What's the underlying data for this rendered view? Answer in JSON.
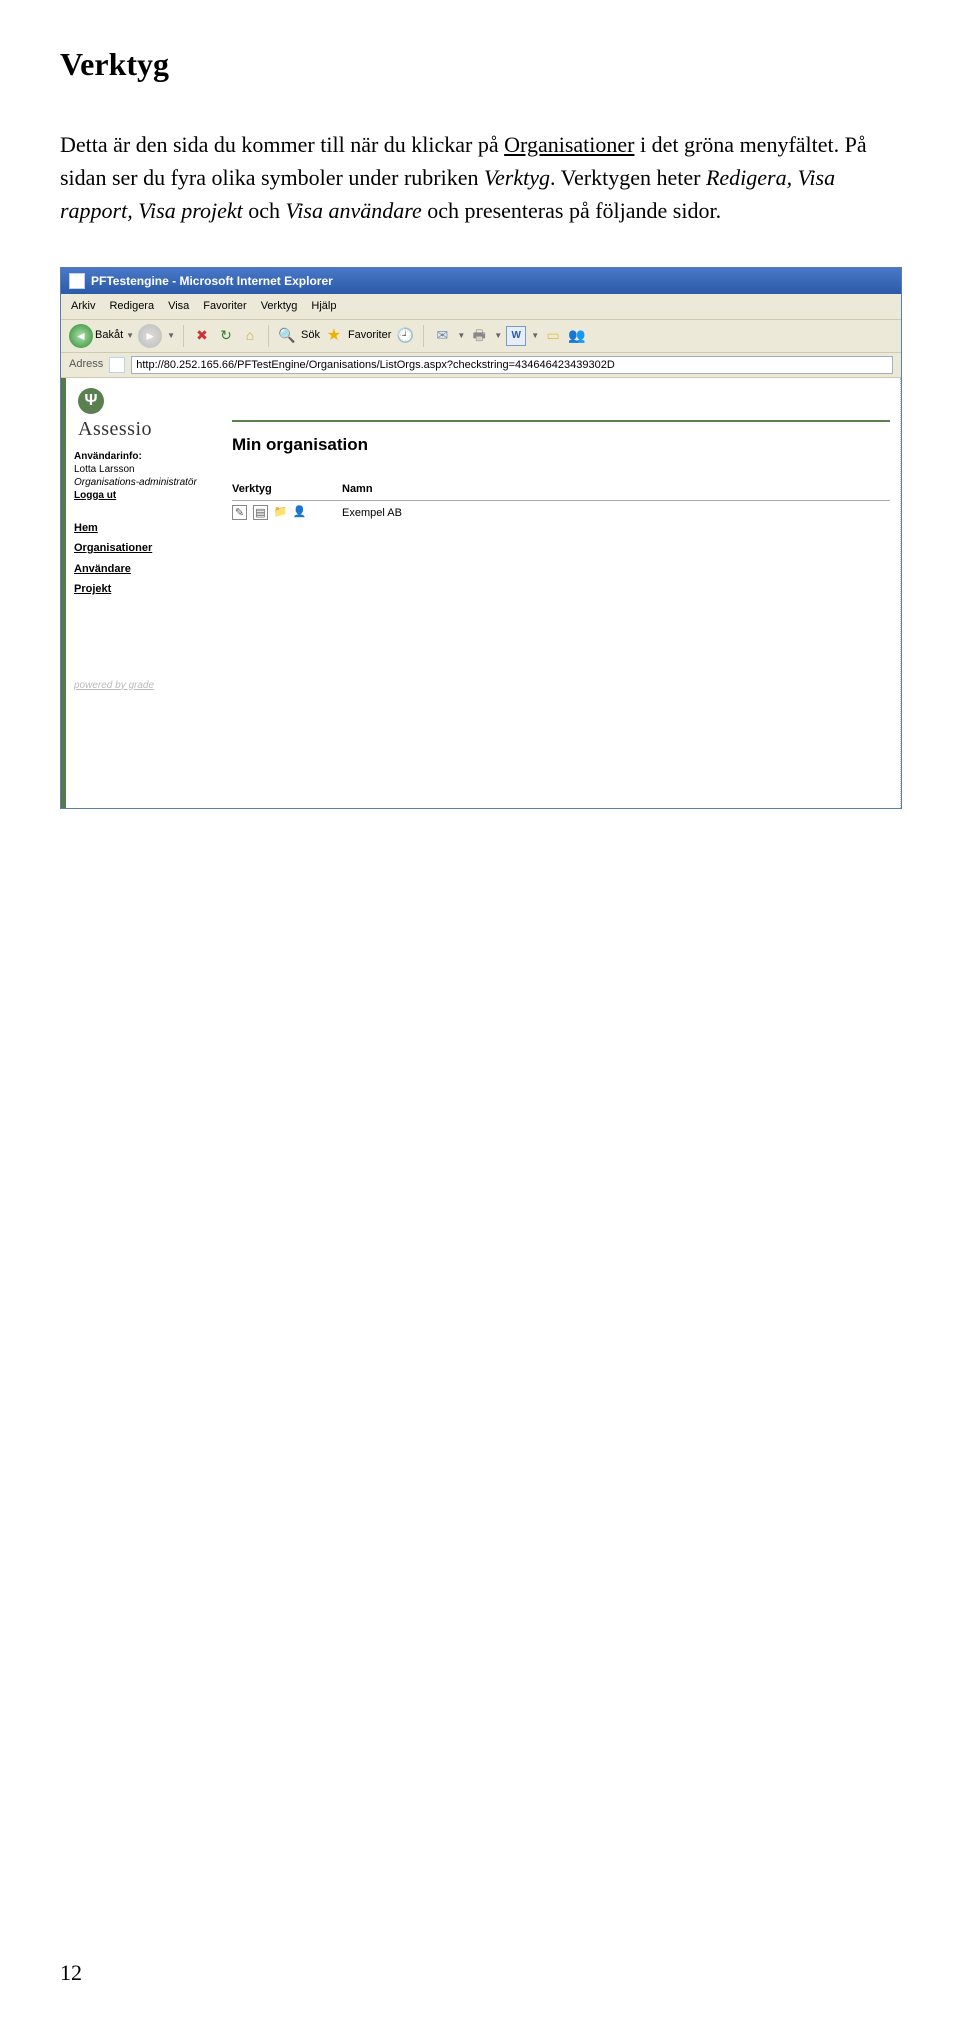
{
  "doc": {
    "heading": "Verktyg",
    "para1a": "Detta är den sida du kommer till när du klickar på ",
    "para1link": "Organisationer",
    "para1b": " i det gröna menyfältet. På sidan ser du fyra olika symboler under rubriken ",
    "para1italic1": "Verktyg",
    "para1c": ". Verktygen heter ",
    "para1italic2": "Redigera, Visa rapport, Visa projekt",
    "para1d": " och ",
    "para1italic3": "Visa användare",
    "para1e": " och presenteras på följande sidor.",
    "pagenum": "12"
  },
  "ie": {
    "title": "PFTestengine - Microsoft Internet Explorer",
    "menu": {
      "arkiv": "Arkiv",
      "redigera": "Redigera",
      "visa": "Visa",
      "favoriter": "Favoriter",
      "verktyg": "Verktyg",
      "hjalp": "Hjälp"
    },
    "toolbar": {
      "back": "Bakåt",
      "search": "Sök",
      "favorites": "Favoriter"
    },
    "address_label": "Adress",
    "address_url": "http://80.252.165.66/PFTestEngine/Organisations/ListOrgs.aspx?checkstring=434646423439302D"
  },
  "app": {
    "logo_text": "Assessio",
    "userinfo_label": "Användarinfo:",
    "user_name": "Lotta Larsson",
    "user_role": "Organisations-administratör",
    "logout": "Logga ut",
    "nav": {
      "hem": "Hem",
      "org": "Organisationer",
      "anv": "Användare",
      "proj": "Projekt"
    },
    "powered": "powered by grade",
    "page_heading": "Min organisation",
    "col_tools": "Verktyg",
    "col_name": "Namn",
    "row_name": "Exempel AB"
  }
}
